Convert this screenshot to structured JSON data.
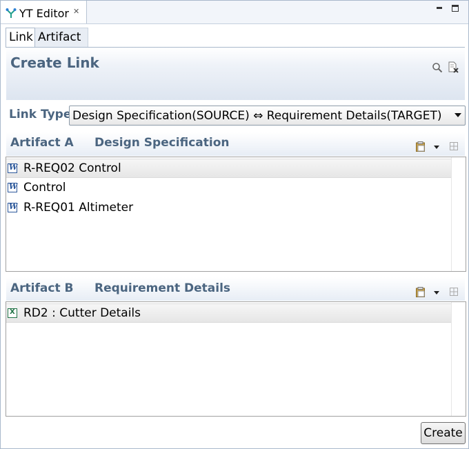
{
  "view": {
    "title": "YT Editor",
    "close_glyph": "✕",
    "icon": "yt-editor-icon"
  },
  "editor_tabs": [
    {
      "label": "Link",
      "selected": true
    },
    {
      "label": "Artifact",
      "selected": false
    }
  ],
  "form": {
    "title": "Create Link"
  },
  "link_type": {
    "label": "Link Type",
    "value": "Design Specification(SOURCE) ⇔ Requirement Details(TARGET)"
  },
  "artifact_a": {
    "label": "Artifact A",
    "type": "Design Specification",
    "items": [
      {
        "text": "R-REQ02 Control",
        "icon": "word-document-icon",
        "selected": true
      },
      {
        "text": "Control",
        "icon": "word-document-icon",
        "selected": false
      },
      {
        "text": "R-REQ01 Altimeter",
        "icon": "word-document-icon",
        "selected": false
      }
    ]
  },
  "artifact_b": {
    "label": "Artifact B",
    "type": "Requirement Details",
    "items": [
      {
        "text": "RD2 : Cutter Details",
        "icon": "excel-document-icon",
        "selected": true
      }
    ]
  },
  "actions": {
    "create_label": "Create"
  },
  "colors": {
    "header_text": "#4b6580",
    "delete_red": "#d9261c",
    "frame_border": "#a9b8cb"
  }
}
